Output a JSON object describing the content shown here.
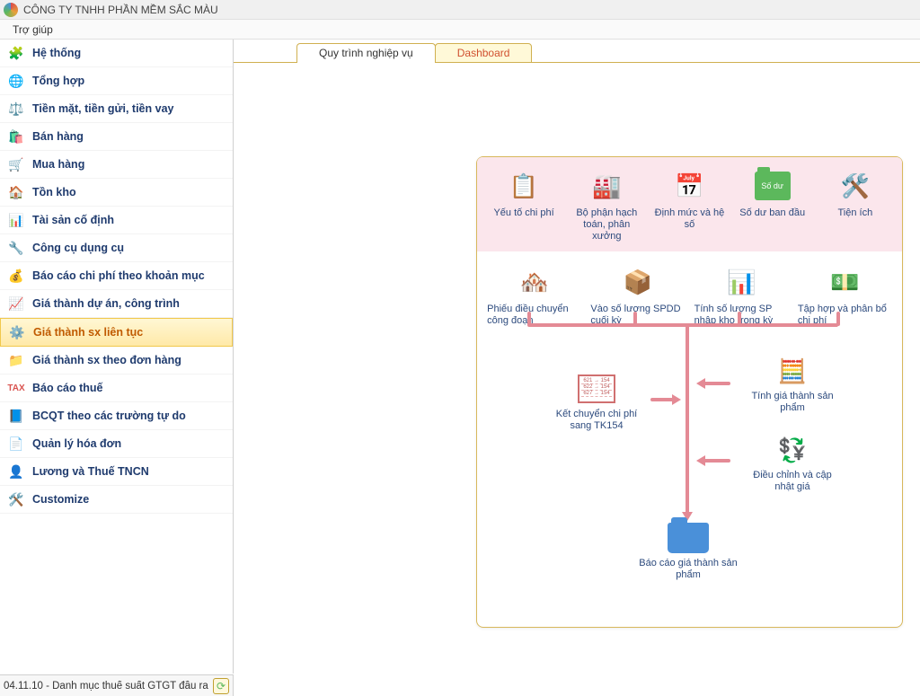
{
  "app": {
    "title": "CÔNG TY TNHH PHẦN MỀM SẮC MÀU"
  },
  "menubar": {
    "help": "Trợ giúp"
  },
  "sidebar": {
    "items": [
      {
        "label": "Hệ thống",
        "icon": "🧩"
      },
      {
        "label": "Tổng hợp",
        "icon": "🌐"
      },
      {
        "label": "Tiền mặt, tiền gửi, tiền vay",
        "icon": "⚖️"
      },
      {
        "label": "Bán hàng",
        "icon": "🛍️"
      },
      {
        "label": "Mua hàng",
        "icon": "🛒"
      },
      {
        "label": "Tồn kho",
        "icon": "🏠"
      },
      {
        "label": "Tài sản cố định",
        "icon": "📊"
      },
      {
        "label": "Công cụ dụng cụ",
        "icon": "🔧"
      },
      {
        "label": "Báo cáo chi phí theo khoản mục",
        "icon": "💰"
      },
      {
        "label": "Giá thành dự án, công trình",
        "icon": "📈"
      },
      {
        "label": "Giá thành sx liên tục",
        "icon": "⚙️"
      },
      {
        "label": "Giá thành sx theo đơn hàng",
        "icon": "📁"
      },
      {
        "label": "Báo cáo thuế",
        "icon": "TAX"
      },
      {
        "label": "BCQT theo các trường tự do",
        "icon": "📘"
      },
      {
        "label": "Quản lý hóa đơn",
        "icon": "📄"
      },
      {
        "label": "Lương và Thuế TNCN",
        "icon": "👤"
      },
      {
        "label": "Customize",
        "icon": "🛠️"
      }
    ],
    "selected_index": 10
  },
  "tabs": {
    "items": [
      {
        "label": "Quy trình nghiệp vụ",
        "active": true
      },
      {
        "label": "Dashboard",
        "active": false
      }
    ]
  },
  "diagram": {
    "row1": [
      {
        "label": "Yếu tố chi phí"
      },
      {
        "label": "Bộ phận hạch toán, phân xưởng"
      },
      {
        "label": "Định mức và hệ số"
      },
      {
        "label": "Số dư ban đầu"
      },
      {
        "label": "Tiện ích"
      }
    ],
    "row2": [
      {
        "label": "Phiếu điều chuyển công đoạn"
      },
      {
        "label": "Vào số lượng SPDD cuối kỳ"
      },
      {
        "label": "Tính số lượng SP nhập kho trong kỳ"
      },
      {
        "label": "Tập hợp và phân bổ chi phí"
      }
    ],
    "mid": {
      "kc": "Kết chuyển chi phí sang TK154",
      "gt": "Tính giá thành sản phẩm",
      "dc": "Điều chỉnh và cập nhật giá",
      "bc": "Báo cáo giá thành sản phẩm"
    },
    "boxlines": [
      "621 → 154",
      "622 → 154",
      "627 → 154"
    ]
  },
  "statusbar": {
    "text": "04.11.10 - Danh mục thuế suất GTGT đầu ra"
  }
}
